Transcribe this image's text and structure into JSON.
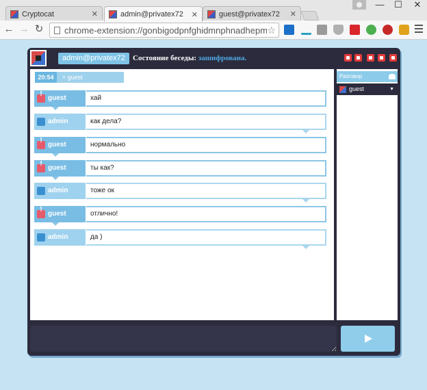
{
  "browser": {
    "tabs": [
      {
        "title": "Cryptocat"
      },
      {
        "title": "admin@privatex72"
      },
      {
        "title": "guest@privatex72"
      }
    ],
    "url": "chrome-extension://gonbigodpnfghidmnphnadhepmbal",
    "window_controls": {
      "minimize": "—",
      "maximize": "☐",
      "close": "✕"
    },
    "extension_icons": [
      "outlook-icon",
      "wave-icon",
      "puzzle-icon",
      "pocket-icon",
      "lastpass-icon",
      "circle-icon",
      "abp-icon",
      "toggle-icon"
    ]
  },
  "app": {
    "user_badge": "admin@privatex72",
    "status_prefix": "Состояние беседы: ",
    "status_value": "зашифрована.",
    "header_buttons": [
      "file-icon",
      "filter-icon",
      "chat-icon",
      "sound-icon",
      "logout-icon"
    ],
    "time_bar": {
      "time": "20:54",
      "user": "guest"
    },
    "messages": [
      {
        "sender": "guest",
        "text": "хай"
      },
      {
        "sender": "admin",
        "text": "как дела?"
      },
      {
        "sender": "guest",
        "text": "нормально"
      },
      {
        "sender": "guest",
        "text": "ты как?"
      },
      {
        "sender": "admin",
        "text": "тоже ок"
      },
      {
        "sender": "guest",
        "text": "отлично!"
      },
      {
        "sender": "admin",
        "text": "да )"
      }
    ],
    "sidebar": {
      "conversation_label": "Разговор",
      "buddy": "guest"
    },
    "input_placeholder": ""
  },
  "colors": {
    "background": "#c5e3f3",
    "app_dark": "#2b2b3d",
    "accent": "#7ec3e6",
    "encrypted": "#4fa7e0",
    "alert": "#e23b3b"
  }
}
